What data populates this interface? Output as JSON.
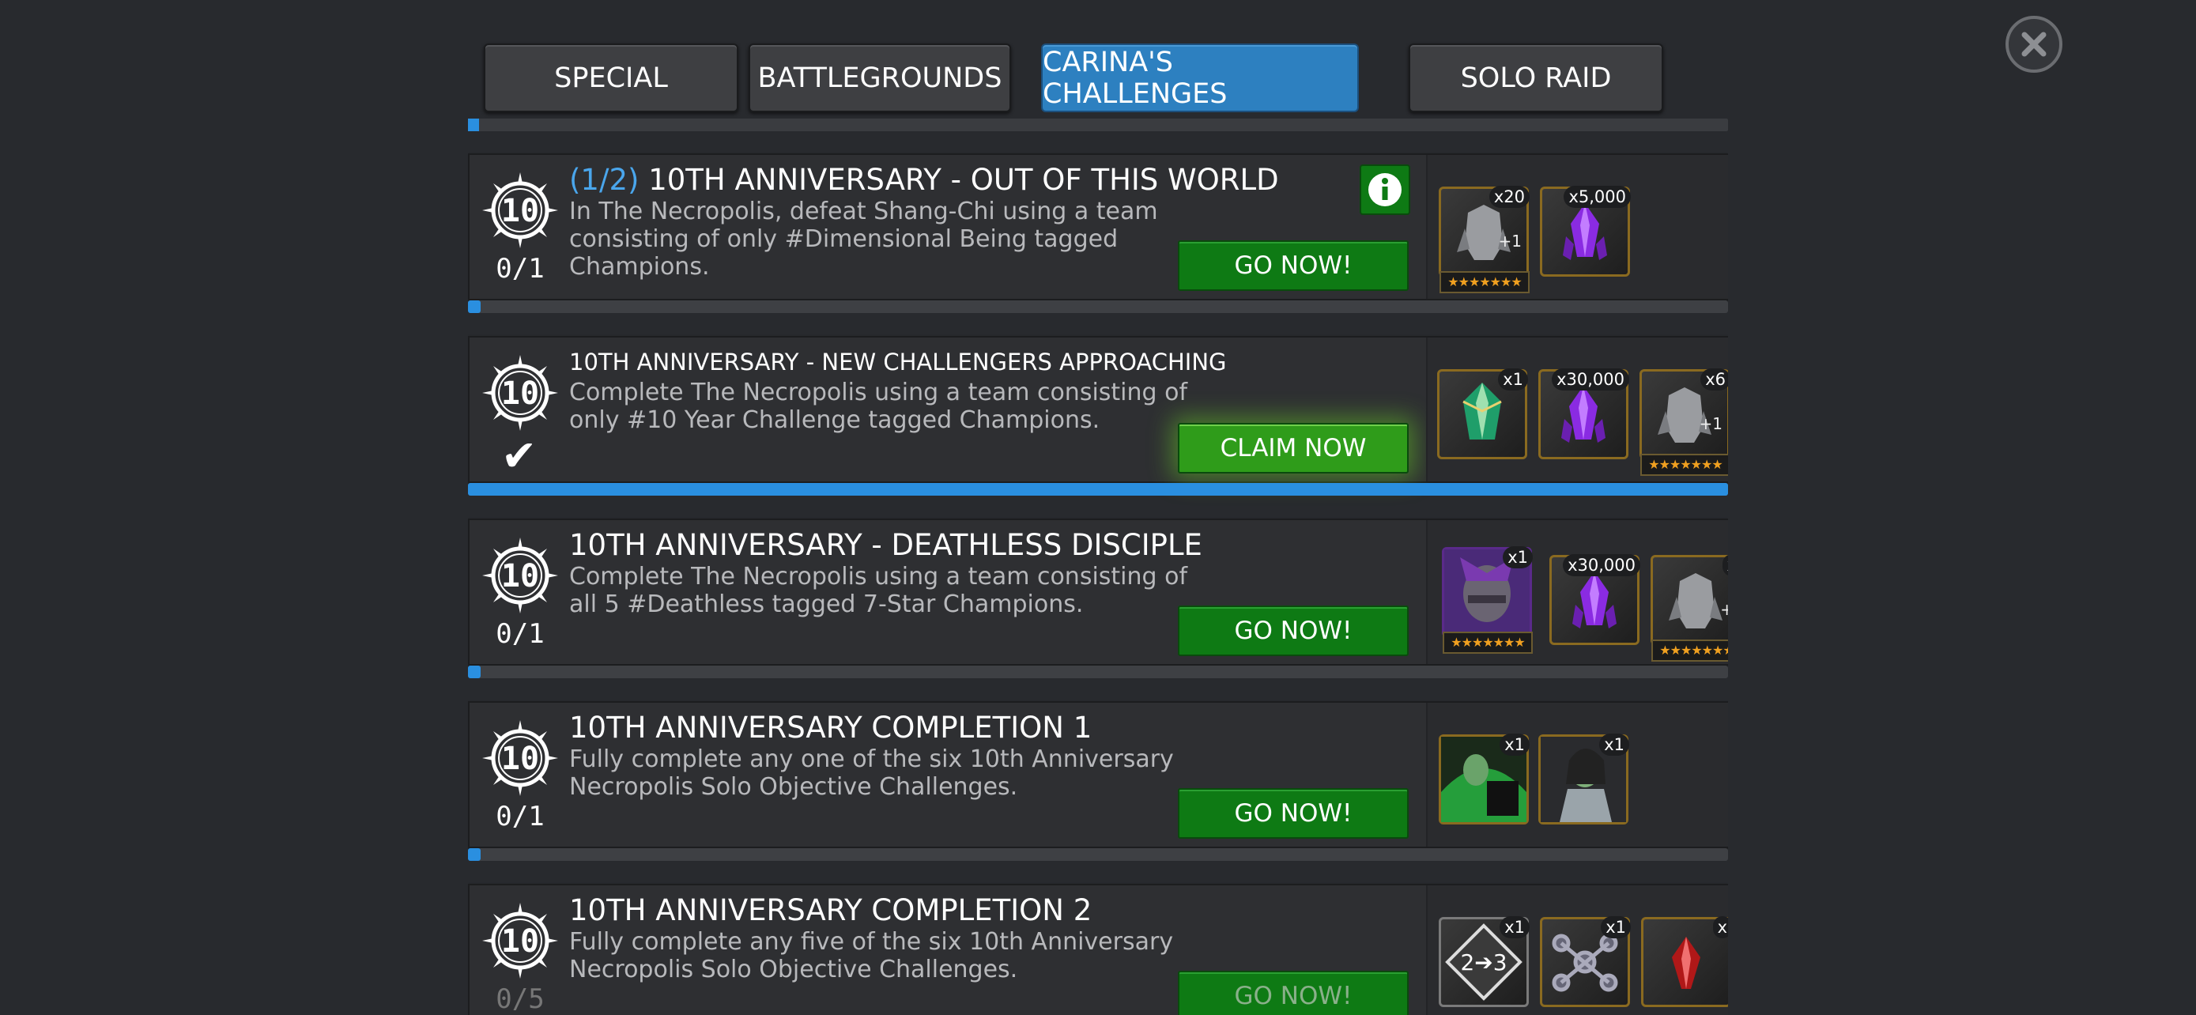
{
  "tabs": [
    {
      "label": "SPECIAL",
      "active": false
    },
    {
      "label": "BATTLEGROUNDS",
      "active": false
    },
    {
      "label": "CARINA'S CHALLENGES",
      "active": true
    },
    {
      "label": "SOLO RAID",
      "active": false
    }
  ],
  "emblem_text": "10",
  "colors": {
    "accent_blue": "#2a8fe0",
    "go_green": "#0e7a14",
    "claim_green": "#2f9c1a",
    "star_gold": "#f0a020"
  },
  "challenges": [
    {
      "title_step": "(1/2)",
      "title": "10TH ANNIVERSARY - OUT OF THIS WORLD",
      "description": "In The Necropolis, defeat Shang-Chi using a team consisting of only #Dimensional Being tagged Champions.",
      "count": "0/1",
      "button": "GO NOW!",
      "has_info": true,
      "progress": 0.01,
      "rewards": [
        {
          "icon": "champion-silhouette-icon",
          "qty": "x20",
          "plus": "+1",
          "stars": "★★★★★★★"
        },
        {
          "icon": "purple-crystal-icon",
          "qty": "x5,000"
        }
      ]
    },
    {
      "title": "10TH ANNIVERSARY - NEW CHALLENGERS APPROACHING",
      "description": "Complete The Necropolis using a team consisting of only #10 Year Challenge tagged Champions.",
      "completed": true,
      "button": "CLAIM NOW",
      "progress": 1.0,
      "rewards": [
        {
          "icon": "green-crystal-icon",
          "qty": "x1"
        },
        {
          "icon": "purple-crystal-icon",
          "qty": "x30,000"
        },
        {
          "icon": "champion-silhouette-icon",
          "qty": "x6",
          "plus": "+1",
          "stars": "★★★★★★★"
        }
      ]
    },
    {
      "title": "10TH ANNIVERSARY - DEATHLESS DISCIPLE",
      "description": "Complete The Necropolis using a team consisting of all 5 #Deathless tagged 7-Star Champions.",
      "count": "0/1",
      "button": "GO NOW!",
      "progress": 0.01,
      "rewards": [
        {
          "icon": "thanos-portrait-icon",
          "qty": "x1",
          "stars": "★★★★★★★"
        },
        {
          "icon": "purple-crystal-icon",
          "qty": "x30,000"
        },
        {
          "icon": "champion-silhouette-icon",
          "qty": "x",
          "plus": "+",
          "stars": "★★★★★★★"
        }
      ]
    },
    {
      "title": "10TH ANNIVERSARY COMPLETION 1",
      "description": "Fully complete any one of the six 10th Anniversary Necropolis Solo Objective Challenges.",
      "count": "0/1",
      "button": "GO NOW!",
      "progress": 0.01,
      "rewards": [
        {
          "icon": "she-hulk-crystal-icon",
          "qty": "x1"
        },
        {
          "icon": "she-hulk-portrait-icon",
          "qty": "x1"
        }
      ]
    },
    {
      "title": "10TH ANNIVERSARY COMPLETION 2",
      "description": "Fully complete any five of the six 10th Anniversary Necropolis Solo Objective Challenges.",
      "count": "0/5",
      "button": "GO NOW!",
      "progress": 0.0,
      "rewards": [
        {
          "icon": "rank-up-2-to-3-icon",
          "qty": "x1",
          "label": "2➔3"
        },
        {
          "icon": "node-catalyst-icon",
          "qty": "x1"
        },
        {
          "icon": "red-crystal-icon",
          "qty": "x"
        }
      ]
    }
  ]
}
